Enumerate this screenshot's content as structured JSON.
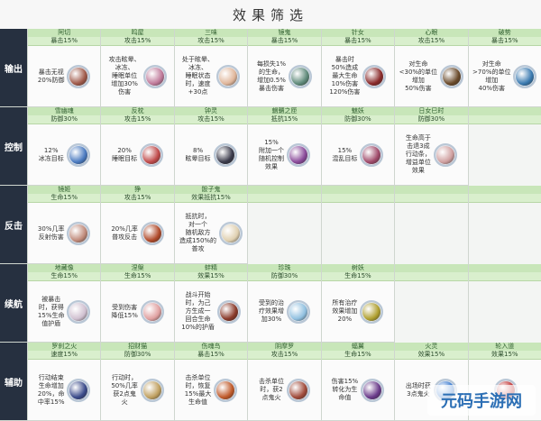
{
  "title": "效果筛选",
  "watermark": "元码手游网",
  "rows": [
    {
      "label": "输出",
      "cells": [
        {
          "name": "阿切",
          "stat": "暴击15%",
          "desc": "暴击无视\n20%防御",
          "avatar": "#a05a4a"
        },
        {
          "name": "鸣屋",
          "stat": "攻击15%",
          "desc": "攻击眩晕、\n冰冻、\n睡眠单位\n增加30%\n伤害",
          "avatar": "#c07a9a"
        },
        {
          "name": "三味",
          "stat": "攻击15%",
          "desc": "处于眩晕、\n冰冻、\n睡眠状态\n时，速度\n+30点",
          "avatar": "#e0b69a"
        },
        {
          "name": "镜鬼",
          "stat": "暴击15%",
          "desc": "每损失1%\n的生命，\n增加0.5%\n暴击伤害",
          "avatar": "#5f8a7a"
        },
        {
          "name": "针女",
          "stat": "暴击15%",
          "desc": "暴击时\n50%造成\n最大生命\n10%伤害\n120%伤害",
          "avatar": "#8a2a2a"
        },
        {
          "name": "心眼",
          "stat": "攻击15%",
          "desc": "对生命\n<30%的单位\n增加\n50%伤害",
          "avatar": "#6a4a2a"
        },
        {
          "name": "破势",
          "stat": "暴击15%",
          "desc": "对生命\n>70%的单位\n增加\n40%伤害",
          "avatar": "#3a7ab0"
        }
      ]
    },
    {
      "label": "控制",
      "cells": [
        {
          "name": "雪幽魂",
          "stat": "防御30%",
          "desc": "12%\n冰冻目标",
          "avatar": "#4a7ac0"
        },
        {
          "name": "反枕",
          "stat": "攻击15%",
          "desc": "20%\n睡眠目标",
          "avatar": "#c04a4a"
        },
        {
          "name": "钟灵",
          "stat": "攻击15%",
          "desc": "8%\n眩晕目标",
          "avatar": "#3a3a4a"
        },
        {
          "name": "魍魉之匣",
          "stat": "抵抗15%",
          "desc": "15%\n附加一个\n随机控制\n效果",
          "avatar": "#8a4a9a"
        },
        {
          "name": "魅妖",
          "stat": "防御30%",
          "desc": "15%\n混乱目标",
          "avatar": "#a04a6a"
        },
        {
          "name": "日女巳时",
          "stat": "防御30%",
          "desc": "生命高于\n击退3成\n行动条，\n增益单位\n效果",
          "avatar": "#d0a0a0"
        },
        {
          "name": "",
          "stat": "",
          "desc": "",
          "avatar": ""
        }
      ]
    },
    {
      "label": "反击",
      "cells": [
        {
          "name": "镜姬",
          "stat": "生命15%",
          "desc": "30%几率\n反射伤害",
          "avatar": "#c08a7a"
        },
        {
          "name": "狰",
          "stat": "攻击15%",
          "desc": "20%几率\n普攻反击",
          "avatar": "#b04a2a"
        },
        {
          "name": "骰子鬼",
          "stat": "效果抵抗15%",
          "desc": "抵抗时，\n对一个\n随机敌方\n造成150%的\n普攻",
          "avatar": "#e0d0b0"
        },
        {
          "name": "",
          "stat": "",
          "desc": "",
          "avatar": ""
        },
        {
          "name": "",
          "stat": "",
          "desc": "",
          "avatar": ""
        },
        {
          "name": "",
          "stat": "",
          "desc": "",
          "avatar": ""
        },
        {
          "name": "",
          "stat": "",
          "desc": "",
          "avatar": ""
        }
      ]
    },
    {
      "label": "续航",
      "cells": [
        {
          "name": "地藏像",
          "stat": "生命15%",
          "desc": "被暴击\n时，获得\n15%生命\n值护盾",
          "avatar": "#d0c0d0"
        },
        {
          "name": "涅槃",
          "stat": "生命15%",
          "desc": "受到伤害\n降低15%",
          "avatar": "#e0a0a0"
        },
        {
          "name": "蚌精",
          "stat": "效果15%",
          "desc": "战斗开始\n时，为己\n方生成一\n回合生命\n10%的护盾",
          "avatar": "#8a3a2a"
        },
        {
          "name": "珍珠",
          "stat": "防御30%",
          "desc": "受到的治\n疗效果增\n加30%",
          "avatar": "#90c0e0"
        },
        {
          "name": "树妖",
          "stat": "生命15%",
          "desc": "所有治疗\n效果增加\n20%",
          "avatar": "#b0a030"
        },
        {
          "name": "",
          "stat": "",
          "desc": "",
          "avatar": ""
        },
        {
          "name": "",
          "stat": "",
          "desc": "",
          "avatar": ""
        }
      ]
    },
    {
      "label": "辅助",
      "cells": [
        {
          "name": "罗刹之火",
          "stat": "速度15%",
          "desc": "行动结束\n生命增加\n20%，命\n中率15%",
          "avatar": "#3a4a8a"
        },
        {
          "name": "招财猫",
          "stat": "防御30%",
          "desc": "行动时，\n50%几率\n获2点鬼\n火",
          "avatar": "#c0a060"
        },
        {
          "name": "伤魂鸟",
          "stat": "暴击15%",
          "desc": "击杀单位\n时，恢复\n15%最大\n生命值",
          "avatar": "#c05a2a"
        },
        {
          "name": "阴摩罗",
          "stat": "攻击15%",
          "desc": "击杀单位\n时，获2\n点鬼火",
          "avatar": "#a04a3a"
        },
        {
          "name": "蝠翼",
          "stat": "生命15%",
          "desc": "伤害15%\n转化为生\n命值",
          "avatar": "#6a3a8a"
        },
        {
          "name": "火灵",
          "stat": "效果15%",
          "desc": "出场时获\n3点鬼火",
          "avatar": "#3a7ad0"
        },
        {
          "name": "轮入道",
          "stat": "效果15%",
          "desc": "",
          "avatar": "#c03030"
        }
      ]
    }
  ]
}
